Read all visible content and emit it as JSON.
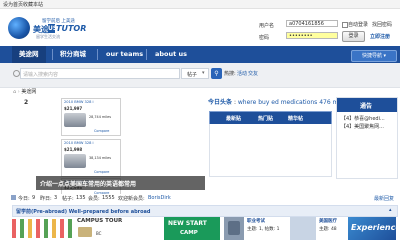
{
  "topbar": {
    "set_home": "设为首页",
    "bookmark": "收藏本站"
  },
  "logo": {
    "tagline_top": "留学前后 上美途",
    "brand_cn": "美途",
    "brand_en": "TUTOR",
    "sub": "留学生活交流"
  },
  "login": {
    "username_label": "用户名",
    "username_value": "a0704161856",
    "password_label": "密码",
    "password_value": "••••••••",
    "auto_login": "自动登录",
    "forgot": "找回密码",
    "login_button": "登录",
    "register": "立即注册"
  },
  "nav": {
    "items": [
      "美途网",
      "积分商城",
      "our teams",
      "about us"
    ],
    "quick": "快捷导航"
  },
  "search": {
    "placeholder": "请输入搜索内容",
    "scope": "帖子",
    "hot_label": "热搜:",
    "hot_items": [
      "活动",
      "交友"
    ]
  },
  "breadcrumb": {
    "home": "美途网"
  },
  "post": {
    "page": "2",
    "listings": [
      {
        "title": "2010 BMW 328 i",
        "price": "$21,997",
        "miles": "28,744 miles",
        "compare": "Compare"
      },
      {
        "title": "2010 BMW 328 i",
        "price": "$21,998",
        "miles": "38,134 miles",
        "compare": "Compare"
      },
      {
        "title": "2010 BMW 328 i",
        "price": "$21,998",
        "miles": "42,221 miles",
        "compare": "Compare"
      }
    ],
    "caption": "介绍一点点美国车常用的英语都常用"
  },
  "news": {
    "today_label": "今日头条",
    "headline": "where buy ed medications 476 mg",
    "table_headers": [
      "最新贴",
      "热门贴",
      "精华帖"
    ]
  },
  "notice": {
    "title": "通告",
    "items": [
      "【4】恭喜@hedi...",
      "【4】美国聚焦网..."
    ]
  },
  "stats": {
    "today_label": "今日:",
    "today": "9",
    "yesterday_label": "昨日:",
    "yesterday": "3",
    "posts_label": "帖子:",
    "posts": "135",
    "members_label": "会员:",
    "members": "1555",
    "welcome_label": "欢迎新会员:",
    "new_member": "BorisDirk",
    "latest_reply": "最新回复"
  },
  "section": {
    "name": "留学前(Pre-abroad) Well-prepared before abroad"
  },
  "bottom": {
    "campus_tour": "CAMPUS TOUR",
    "new_start": "NEW START",
    "camp": "CAMP",
    "bc": "BC",
    "category": "职业考试",
    "stat1": "主题: 1, 帖数: 1",
    "category2": "美国医疗",
    "stat2": "主题: 48",
    "experience": "Experience"
  }
}
